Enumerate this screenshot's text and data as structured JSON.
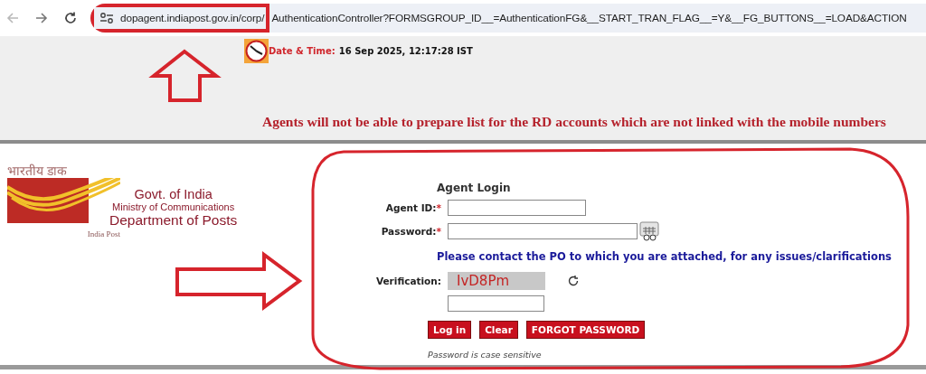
{
  "browser": {
    "url": [
      "dopagent.indiapost.gov.in/corp/",
      "AuthenticationController?FORMSGROUP_ID__=AuthenticationFG&__START_TRAN_FLAG__=Y&__FG_BUTTONS__=LOAD&ACTION"
    ]
  },
  "header": {
    "date_label": "Date & Time:",
    "date_value": "16 Sep 2025, 12:17:28 IST",
    "notice": "Agents will not be able to prepare list for the RD accounts which are not linked with the mobile numbers"
  },
  "logo": {
    "hindi": "भारतीय डाक",
    "caption": "India Post",
    "lines": [
      "Govt. of India",
      "Ministry of Communications",
      "Department of Posts"
    ]
  },
  "login": {
    "title": "Agent Login",
    "fields": [
      {
        "label": "Agent ID:",
        "mark": "*",
        "kind": "text"
      },
      {
        "label": "Password:",
        "mark": "*",
        "kind": "password"
      }
    ],
    "notice": "Please contact the PO to which you are attached, for any issues/clarifications",
    "verification": {
      "label": "Verification:",
      "captcha": "IvD8Pm"
    },
    "buttons": [
      "Log in",
      "Clear",
      "FORGOT PASSWORD"
    ],
    "hint": "Password is case sensitive"
  },
  "annotations": [
    {
      "kind": "box"
    },
    {
      "kind": "up-arrow"
    },
    {
      "kind": "right-arrow"
    },
    {
      "kind": "ring"
    }
  ]
}
